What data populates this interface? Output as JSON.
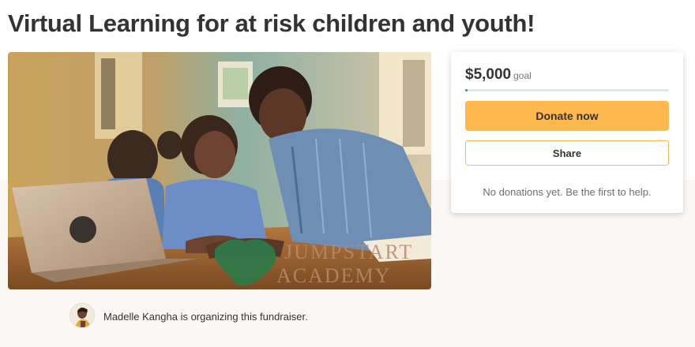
{
  "campaign": {
    "title": "Virtual Learning for at risk children and youth!",
    "image_text": [
      "JUMPSTART",
      "ACADEMY"
    ]
  },
  "donation": {
    "amount": "$5,000",
    "goal_label": "goal",
    "progress_fraction": 0.01,
    "donate_label": "Donate now",
    "share_label": "Share",
    "status_text": "No donations yet. Be the first to help."
  },
  "organizer": {
    "text": "Madelle Kangha is organizing this fundraiser."
  },
  "colors": {
    "accent": "#ffb84d",
    "progress": "#02a95c",
    "progress_track": "#cfeee3"
  }
}
